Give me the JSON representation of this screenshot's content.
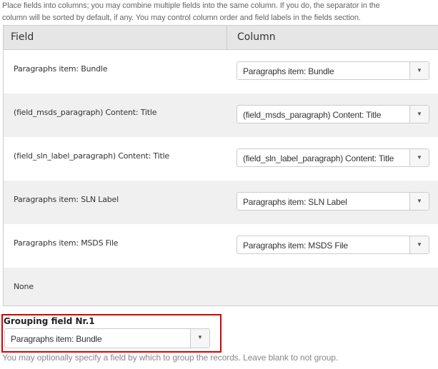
{
  "description": [
    "Place fields into columns; you may combine multiple fields into the same column. If you do, the separator in the",
    "column will be sorted by default, if any. You may control column order and field labels in the fields section."
  ],
  "table": {
    "headers": {
      "field": "Field",
      "column": "Column"
    },
    "rows": [
      {
        "field": "Paragraphs item: Bundle",
        "column": "Paragraphs item: Bundle"
      },
      {
        "field": "(field_msds_paragraph) Content: Title",
        "column": "(field_msds_paragraph) Content: Title"
      },
      {
        "field": "(field_sln_label_paragraph) Content: Title",
        "column": "(field_sln_label_paragraph) Content: Title"
      },
      {
        "field": "Paragraphs item: SLN Label",
        "column": "Paragraphs item: SLN Label"
      },
      {
        "field": "Paragraphs item: MSDS File",
        "column": "Paragraphs item: MSDS File"
      }
    ],
    "none_label": "None"
  },
  "grouping": {
    "label": "Grouping field Nr.1",
    "value": "Paragraphs item: Bundle",
    "help": "You may optionally specify a field by which to group the records. Leave blank to not group."
  },
  "icons": {
    "dropdown": "▼"
  },
  "colors": {
    "highlight": "#d90000"
  }
}
